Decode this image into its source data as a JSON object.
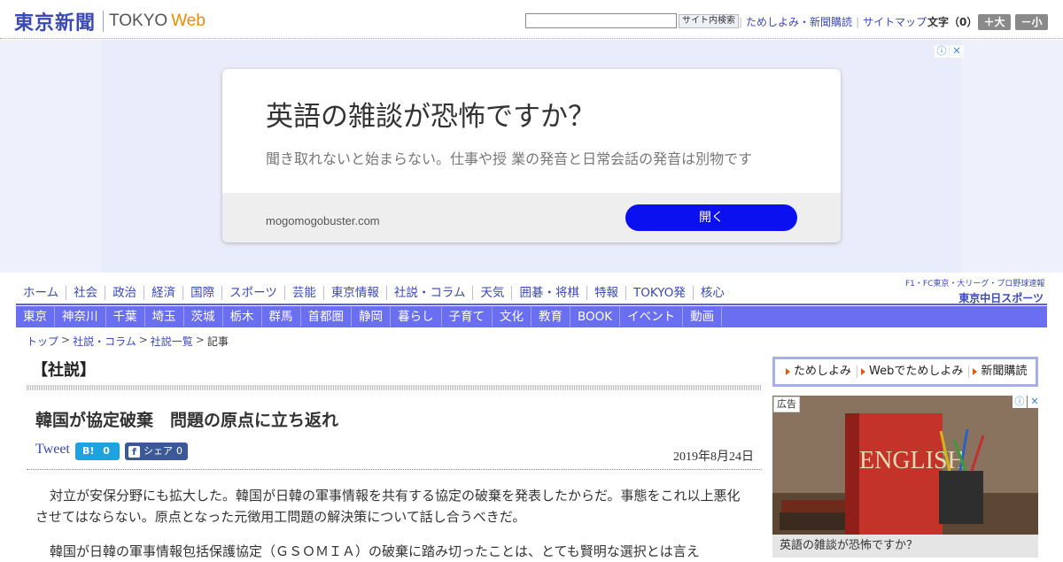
{
  "header": {
    "logo_jp": "東京新聞",
    "logo_tokyo": "TOKYO",
    "logo_web": "Web",
    "search_placeholder": "",
    "search_button": "サイト内検索",
    "links": [
      "ためしよみ・新聞購読",
      "サイトマップ"
    ],
    "moji_label": "文字（0）",
    "enlarge": "＋大",
    "shrink": "－小"
  },
  "ad": {
    "title": "英語の雑談が恐怖ですか？",
    "description": "聞き取れないと始まらない。仕事や授 業の発音と日常会話の発音は別物です",
    "domain": "mogomogobuster.com",
    "open_button": "開く"
  },
  "nav_primary": [
    "ホーム",
    "社会",
    "政治",
    "経済",
    "国際",
    "スポーツ",
    "芸能",
    "東京情報",
    "社説・コラム",
    "天気",
    "囲碁・将棋",
    "特報",
    "TOKYO発",
    "核心"
  ],
  "chunichi": {
    "top": "F1・FC東京・大リーグ・プロ野球速報",
    "main": "東京中日スポーツ"
  },
  "nav_secondary": [
    "東京",
    "神奈川",
    "千葉",
    "埼玉",
    "茨城",
    "栃木",
    "群馬",
    "首都圏",
    "静岡",
    "暮らし",
    "子育て",
    "文化",
    "教育",
    "BOOK",
    "イベント",
    "動画"
  ],
  "breadcrumb": [
    "トップ",
    "社説・コラム",
    "社説一覧",
    "記事"
  ],
  "article": {
    "section": "【社説】",
    "headline": "韓国が協定破棄　問題の原点に立ち返れ",
    "tweet": "Tweet",
    "hatena_count": "0",
    "fb_share": "シェア",
    "fb_count": "0",
    "date": "2019年8月24日",
    "paragraphs": [
      "対立が安保分野にも拡大した。韓国が日韓の軍事情報を共有する協定の破棄を発表したからだ。事態をこれ以上悪化させてはならない。原点となった元徴用工問題の解決策について話し合うべきだ。",
      "韓国が日韓の軍事情報包括保護協定（ＧＳＯＭＩＡ）の破棄に踏み切ったことは、とても賢明な選択とは言え"
    ]
  },
  "sidebar": {
    "links": [
      "ためしよみ",
      "Webでためしよみ",
      "新聞購読"
    ],
    "ad_label": "広告",
    "ad_caption": "英語の雑談が恐怖ですか？",
    "ad_image_text": "ENGLISH"
  }
}
